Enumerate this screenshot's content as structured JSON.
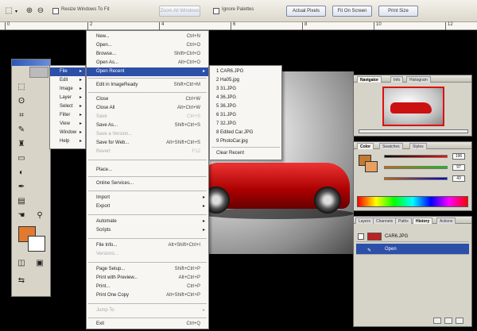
{
  "optionsBar": {
    "icons": [
      "marquee-tool-icon",
      "zoom-in-icon",
      "zoom-out-icon"
    ],
    "chk1_label": "Resize Windows To Fit",
    "chk2_label": "Ignore Palettes",
    "btn_actual": "Actual Pixels",
    "btn_fit": "Fit On Screen",
    "btn_print": "Print Size",
    "btn_dim": "Zoom All Windows"
  },
  "ruler": {
    "labels": [
      "0",
      "2",
      "4",
      "6",
      "8",
      "10",
      "12"
    ]
  },
  "fileMenu": {
    "items": [
      {
        "label": "New...",
        "shortcut": "Ctrl+N"
      },
      {
        "label": "Open...",
        "shortcut": "Ctrl+O"
      },
      {
        "label": "Browse...",
        "shortcut": "Shift+Ctrl+O"
      },
      {
        "label": "Open As...",
        "shortcut": "Alt+Ctrl+O"
      },
      {
        "label": "Open Recent",
        "shortcut": ""
      },
      {
        "label": "Edit in ImageReady",
        "shortcut": "Shift+Ctrl+M"
      },
      {
        "label": "Close",
        "shortcut": "Ctrl+W"
      },
      {
        "label": "Close All",
        "shortcut": "Alt+Ctrl+W"
      },
      {
        "label": "Save",
        "shortcut": "Ctrl+S"
      },
      {
        "label": "Save As...",
        "shortcut": "Shift+Ctrl+S"
      },
      {
        "label": "Save a Version...",
        "shortcut": ""
      },
      {
        "label": "Save for Web...",
        "shortcut": "Alt+Shift+Ctrl+S"
      },
      {
        "label": "Revert",
        "shortcut": "F12"
      },
      {
        "label": "Place...",
        "shortcut": ""
      },
      {
        "label": "Online Services...",
        "shortcut": ""
      },
      {
        "label": "Import",
        "shortcut": ""
      },
      {
        "label": "Export",
        "shortcut": ""
      },
      {
        "label": "Automate",
        "shortcut": ""
      },
      {
        "label": "Scripts",
        "shortcut": ""
      },
      {
        "label": "File Info...",
        "shortcut": "Alt+Shift+Ctrl+I"
      },
      {
        "label": "Versions...",
        "shortcut": ""
      },
      {
        "label": "Page Setup...",
        "shortcut": "Shift+Ctrl+P"
      },
      {
        "label": "Print with Preview...",
        "shortcut": "Alt+Ctrl+P"
      },
      {
        "label": "Print...",
        "shortcut": "Ctrl+P"
      },
      {
        "label": "Print One Copy",
        "shortcut": "Alt+Shift+Ctrl+P"
      },
      {
        "label": "Jump To",
        "shortcut": ""
      },
      {
        "label": "Exit",
        "shortcut": "Ctrl+Q"
      }
    ]
  },
  "mainMenu": {
    "items": [
      "File",
      "Edit",
      "Image",
      "Layer",
      "Select",
      "Filter",
      "View",
      "Window",
      "Help"
    ]
  },
  "recentMenu": {
    "items": [
      "1 CAR6.JPG",
      "2 Ha05.jpg",
      "3 31.JPG",
      "4 36.JPG",
      "5 36.JPG",
      "6 31.JPG",
      "7 32.JPG",
      "8 Edited Car.JPG",
      "9 PhotoCar.jpg",
      "Clear Recent"
    ]
  },
  "navigator": {
    "tabs": [
      "Navigator",
      "Info",
      "Histogram"
    ]
  },
  "colorPanel": {
    "tabs": [
      "Color",
      "Swatches",
      "Styles"
    ],
    "values": [
      "196",
      "97",
      "43"
    ]
  },
  "layers": {
    "tabs": [
      "Layers",
      "Channels",
      "Paths",
      "History",
      "Actions"
    ],
    "rows": [
      "CAR6.JPG",
      "Open"
    ]
  }
}
